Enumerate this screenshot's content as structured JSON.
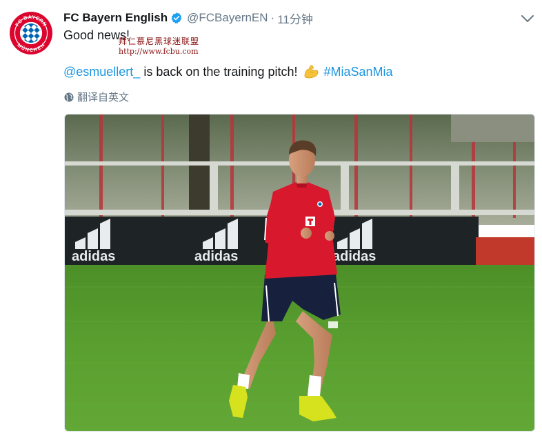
{
  "tweet": {
    "display_name": "FC Bayern English",
    "handle": "@FCBayernEN",
    "separator": "·",
    "time": "11分钟",
    "line1": "Good news!",
    "mention": "@esmuellert_",
    "body_text": "is back on the training pitch!",
    "hashtag": "#MiaSanMia",
    "translate_label": "翻译自英文"
  },
  "watermark": {
    "line1": "拜仁慕尼黑球迷联盟",
    "line2": "http://www.fcbu.com"
  },
  "avatar": {
    "logo_top": "FC BAYERN",
    "logo_bottom": "MÜNCHEN"
  },
  "photo": {
    "banner_text": "adidas"
  },
  "icons": {
    "verified": "verified-badge-icon",
    "chevron": "chevron-down-icon",
    "emoji": "flexed-biceps-emoji",
    "globe": "globe-icon"
  },
  "colors": {
    "link": "#1b95e0",
    "muted": "#657786",
    "bayern_red": "#dc052d",
    "bayern_blue": "#0066b2"
  }
}
